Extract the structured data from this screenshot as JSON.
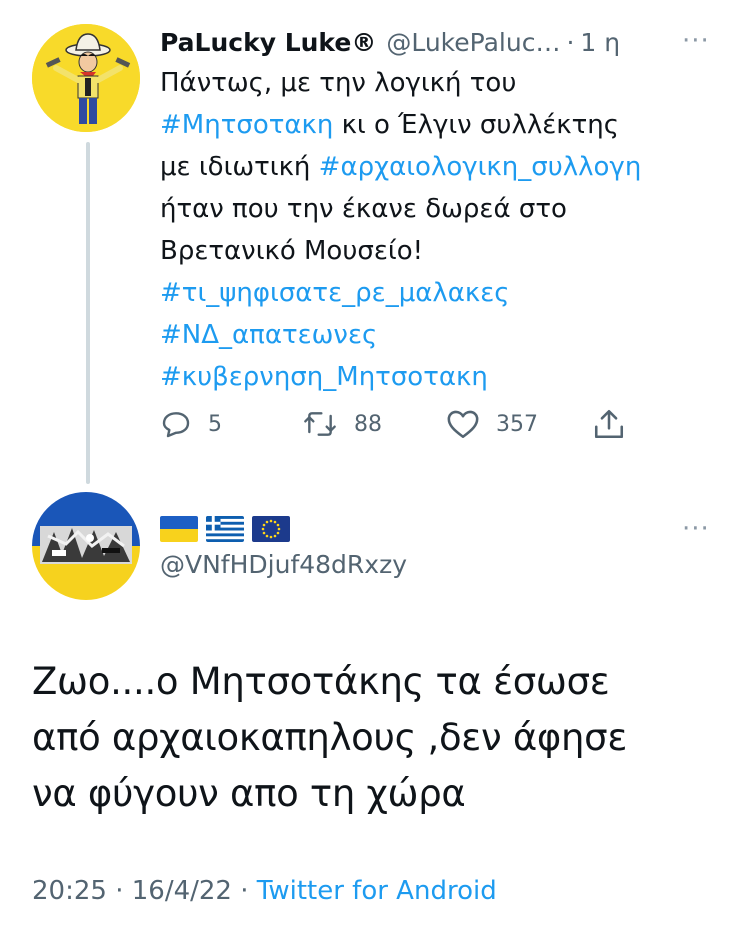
{
  "reply_to": {
    "display_name": "PaLucky Luke®",
    "handle": "@LukePaluc…",
    "separator": "·",
    "time": "1 η",
    "more": "···",
    "text_lines": [
      [
        {
          "t": "Πάντως, με την λογική του",
          "tag": false
        }
      ],
      [
        {
          "t": "#Μητσοτακη",
          "tag": true
        },
        {
          "t": " κι ο Έλγιν συλλέκτης",
          "tag": false
        }
      ],
      [
        {
          "t": "με ιδιωτική ",
          "tag": false
        },
        {
          "t": "#αρχαιολογικη_συλλογη",
          "tag": true
        }
      ],
      [
        {
          "t": "ήταν που την έκανε δωρεά στο",
          "tag": false
        }
      ],
      [
        {
          "t": "Βρετανικό Μουσείο!",
          "tag": false
        }
      ],
      [
        {
          "t": "#τι_ψηφισατε_ρε_μαλακες",
          "tag": true
        }
      ],
      [
        {
          "t": "#ΝΔ_απατεωνες",
          "tag": true
        }
      ],
      [
        {
          "t": "#κυβερνηση_Μητσοτακη",
          "tag": true
        }
      ]
    ],
    "replies": "5",
    "retweets": "88",
    "likes": "357",
    "avatar_icon": "cowboy-cartoon-avatar"
  },
  "main_tweet": {
    "display_name_flags": [
      "ukraine-flag",
      "greece-flag",
      "eu-flag"
    ],
    "handle": "@VNfHDjuf48dRxzy",
    "more": "···",
    "text": "Ζωο....ο Μητσοτάκης τα έσωσε από αρχαιοκαπηλους ,δεν άφησε να φύγουν απο τη χώρα",
    "text_lines": [
      "Ζωο....ο Μητσοτάκης τα έσωσε",
      "από αρχαιοκαπηλους ,δεν άφησε",
      "να φύγουν απο τη χώρα"
    ],
    "time": "20:25",
    "sep1": "·",
    "date": "16/4/22",
    "sep2": "·",
    "source": "Twitter for Android",
    "avatar_icon": "guernica-ukraine-avatar"
  },
  "colors": {
    "link": "#1d9bf0",
    "text": "#0f1419",
    "secondary": "#536471",
    "thread_line": "#cfd9de"
  }
}
